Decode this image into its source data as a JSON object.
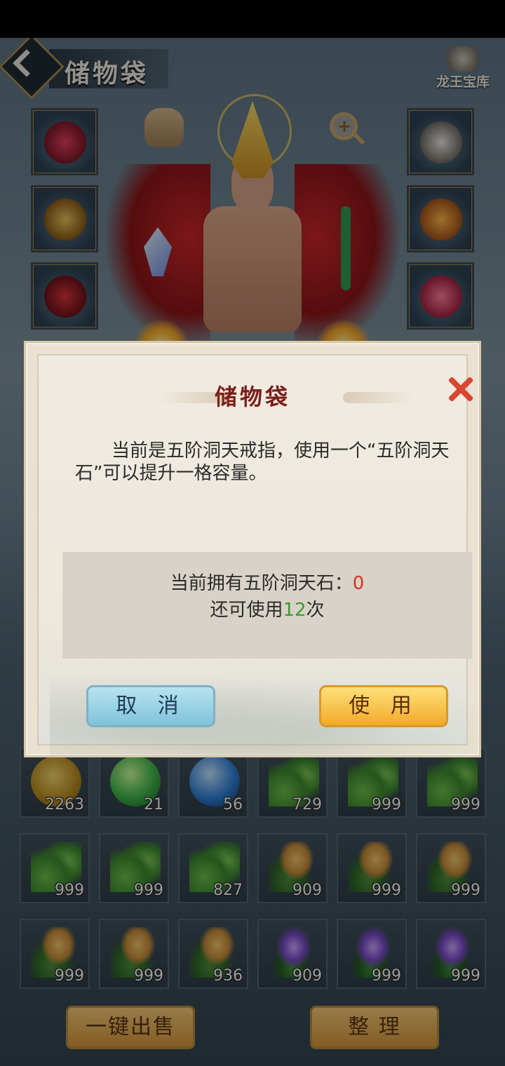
{
  "header": {
    "title": "储物袋",
    "treasury_label": "龙王宝库"
  },
  "inventory": [
    {
      "icon": "gold-ingot",
      "count": "2263"
    },
    {
      "icon": "green-orb",
      "count": "21"
    },
    {
      "icon": "blue-orb",
      "count": "56"
    },
    {
      "icon": "green-herb",
      "count": "729"
    },
    {
      "icon": "green-herb",
      "count": "999"
    },
    {
      "icon": "green-herb",
      "count": "999"
    },
    {
      "icon": "green-herb",
      "count": "999"
    },
    {
      "icon": "green-herb",
      "count": "999"
    },
    {
      "icon": "green-herb",
      "count": "827"
    },
    {
      "icon": "golden-lily",
      "count": "909"
    },
    {
      "icon": "golden-lily",
      "count": "999"
    },
    {
      "icon": "golden-lily",
      "count": "999"
    },
    {
      "icon": "golden-lily",
      "count": "999"
    },
    {
      "icon": "golden-lily",
      "count": "999"
    },
    {
      "icon": "golden-lily",
      "count": "936"
    },
    {
      "icon": "purple-lotus",
      "count": "909"
    },
    {
      "icon": "purple-lotus",
      "count": "999"
    },
    {
      "icon": "purple-lotus",
      "count": "999"
    }
  ],
  "footer": {
    "sell_all_label": "一键出售",
    "sort_label": "整 理"
  },
  "dialog": {
    "title": "储物袋",
    "message": "当前是五阶洞天戒指，使用一个“五阶洞天石”可以提升一格容量。",
    "owned_prefix": "当前拥有五阶洞天石：",
    "owned_count": "0",
    "remaining_prefix": "还可使用",
    "remaining_count": "12",
    "remaining_suffix": "次",
    "cancel_label": "取 消",
    "use_label": "使 用"
  },
  "colors": {
    "accent_red": "#d8361f",
    "accent_green": "#3b9b2a",
    "title_red": "#7b1f1a"
  }
}
